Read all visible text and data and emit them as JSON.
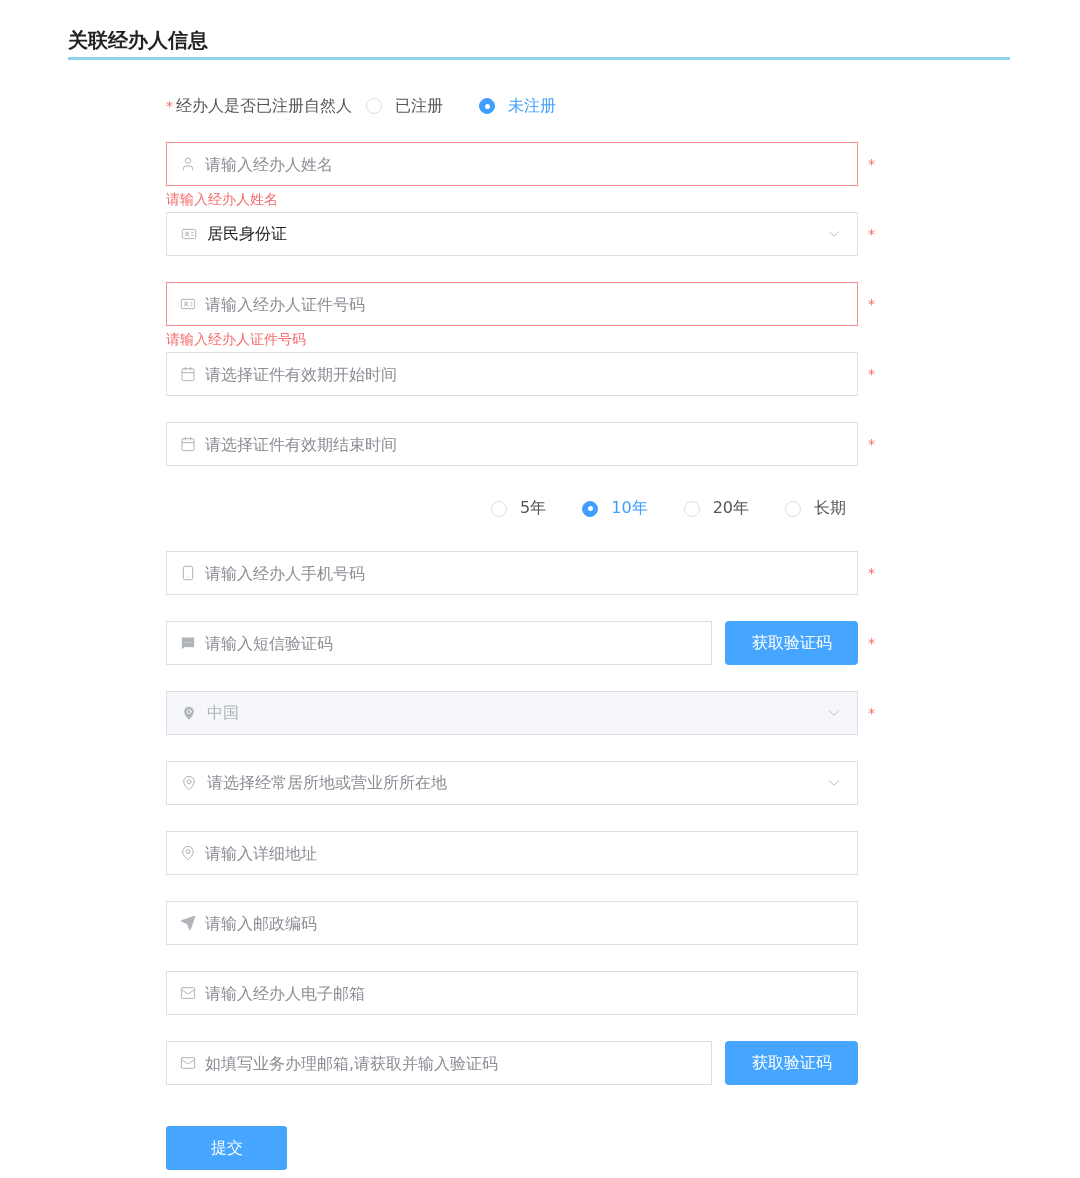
{
  "section_title": "关联经办人信息",
  "registered_question": {
    "asterisk": "*",
    "label": "经办人是否已注册自然人",
    "options": [
      {
        "label": "已注册",
        "selected": false
      },
      {
        "label": "未注册",
        "selected": true
      }
    ]
  },
  "fields": [
    {
      "kind": "input",
      "placeholder": "请输入经办人姓名",
      "invalid": true,
      "error": "请输入经办人姓名",
      "asterisk": "*"
    },
    {
      "kind": "select",
      "value": "居民身份证",
      "asterisk": "*",
      "disabled": false
    },
    {
      "kind": "input",
      "placeholder": "请输入经办人证件号码",
      "invalid": true,
      "error": "请输入经办人证件号码",
      "asterisk": "*"
    },
    {
      "kind": "input",
      "placeholder": "请选择证件有效期开始时间",
      "invalid": false,
      "asterisk": "*"
    },
    {
      "kind": "input",
      "placeholder": "请选择证件有效期结束时间",
      "invalid": false,
      "asterisk": "*"
    },
    {
      "kind": "radios",
      "options": [
        {
          "label": "5年",
          "selected": false
        },
        {
          "label": "10年",
          "selected": true
        },
        {
          "label": "20年",
          "selected": false
        },
        {
          "label": "长期",
          "selected": false
        }
      ]
    },
    {
      "kind": "input",
      "placeholder": "请输入经办人手机号码",
      "invalid": false,
      "asterisk": "*"
    },
    {
      "kind": "input_button",
      "placeholder": "请输入短信验证码",
      "button": "获取验证码",
      "asterisk": "*"
    },
    {
      "kind": "select",
      "value": "中国",
      "asterisk": "*",
      "disabled": true
    },
    {
      "kind": "select",
      "placeholder": "请选择经常居所地或营业所所在地",
      "disabled": false
    },
    {
      "kind": "input",
      "placeholder": "请输入详细地址",
      "invalid": false
    },
    {
      "kind": "input",
      "placeholder": "请输入邮政编码",
      "invalid": false
    },
    {
      "kind": "input",
      "placeholder": "请输入经办人电子邮箱",
      "invalid": false
    },
    {
      "kind": "input_button",
      "placeholder": "如填写业务办理邮箱,请获取并输入验证码",
      "button": "获取验证码"
    }
  ],
  "submit_button": "提交"
}
